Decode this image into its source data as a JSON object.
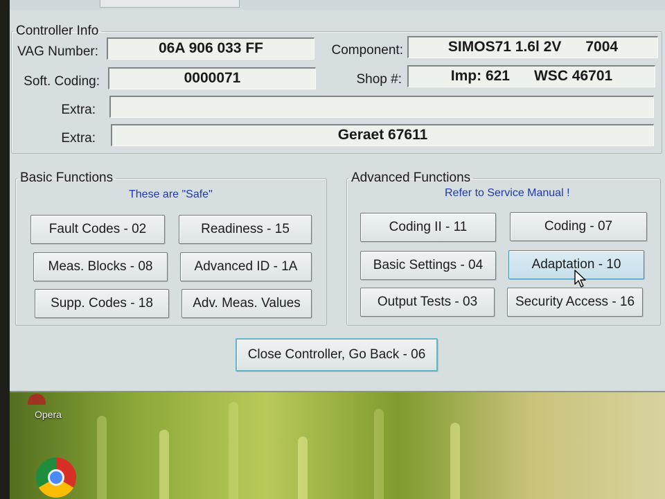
{
  "controller_info": {
    "legend": "Controller Info",
    "vag_number": {
      "label": "VAG Number:",
      "value": "06A 906 033 FF"
    },
    "component": {
      "label": "Component:",
      "value": "SIMOS71 1.6l 2V      7004"
    },
    "soft_coding": {
      "label": "Soft. Coding:",
      "value": "0000071"
    },
    "shop": {
      "label": "Shop #:",
      "value": "Imp: 621      WSC 46701"
    },
    "extra1": {
      "label": "Extra:",
      "value": ""
    },
    "extra2": {
      "label": "Extra:",
      "value": "Geraet 67611"
    }
  },
  "basic_functions": {
    "legend": "Basic Functions",
    "note": "These are \"Safe\"",
    "buttons": [
      "Fault Codes - 02",
      "Readiness - 15",
      "Meas. Blocks - 08",
      "Advanced ID - 1A",
      "Supp. Codes - 18",
      "Adv. Meas. Values"
    ]
  },
  "advanced_functions": {
    "legend": "Advanced Functions",
    "note": "Refer to Service Manual !",
    "buttons": [
      "Coding II - 11",
      "Coding - 07",
      "Basic Settings - 04",
      "Adaptation - 10",
      "Output Tests - 03",
      "Security Access - 16"
    ]
  },
  "close_button": "Close Controller, Go Back - 06",
  "desktop": {
    "icon_label": "Opera"
  },
  "icons": {
    "cursor": "mouse-pointer-icon",
    "opera": "opera-icon",
    "chrome": "chrome-icon"
  }
}
